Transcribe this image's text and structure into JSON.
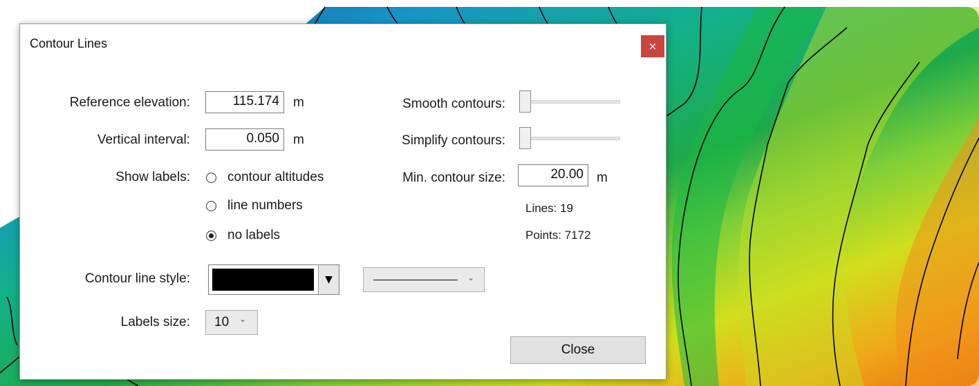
{
  "dialog": {
    "title": "Contour Lines",
    "close_icon": "×",
    "reference_elevation": {
      "label": "Reference elevation:",
      "value": "115.174",
      "unit": "m"
    },
    "vertical_interval": {
      "label": "Vertical interval:",
      "value": "0.050",
      "unit": "m"
    },
    "show_labels": {
      "label": "Show labels:",
      "options": [
        "contour altitudes",
        "line numbers",
        "no labels"
      ],
      "selected": "no labels"
    },
    "smooth_contours": {
      "label": "Smooth contours:",
      "level": 0
    },
    "simplify_contours": {
      "label": "Simplify contours:",
      "level": 0
    },
    "min_contour_size": {
      "label": "Min. contour size:",
      "value": "20.00",
      "unit": "m"
    },
    "stats": {
      "lines": "Lines: 19",
      "points": "Points: 7172"
    },
    "contour_line_style": {
      "label": "Contour line style:",
      "color": "#000000",
      "line_style": "solid"
    },
    "labels_size": {
      "label": "Labels size:",
      "value": "10"
    },
    "close_button": "Close"
  },
  "icons": {
    "close": "close-icon",
    "dropdown": "chevron-down-icon",
    "color_dropdown": "caret-down-icon"
  },
  "map_colors": {
    "deep_blue": "#1f5fae",
    "cyan": "#19a9c9",
    "green": "#1fb34a",
    "lime": "#c8dd21",
    "orange": "#f08a16"
  }
}
